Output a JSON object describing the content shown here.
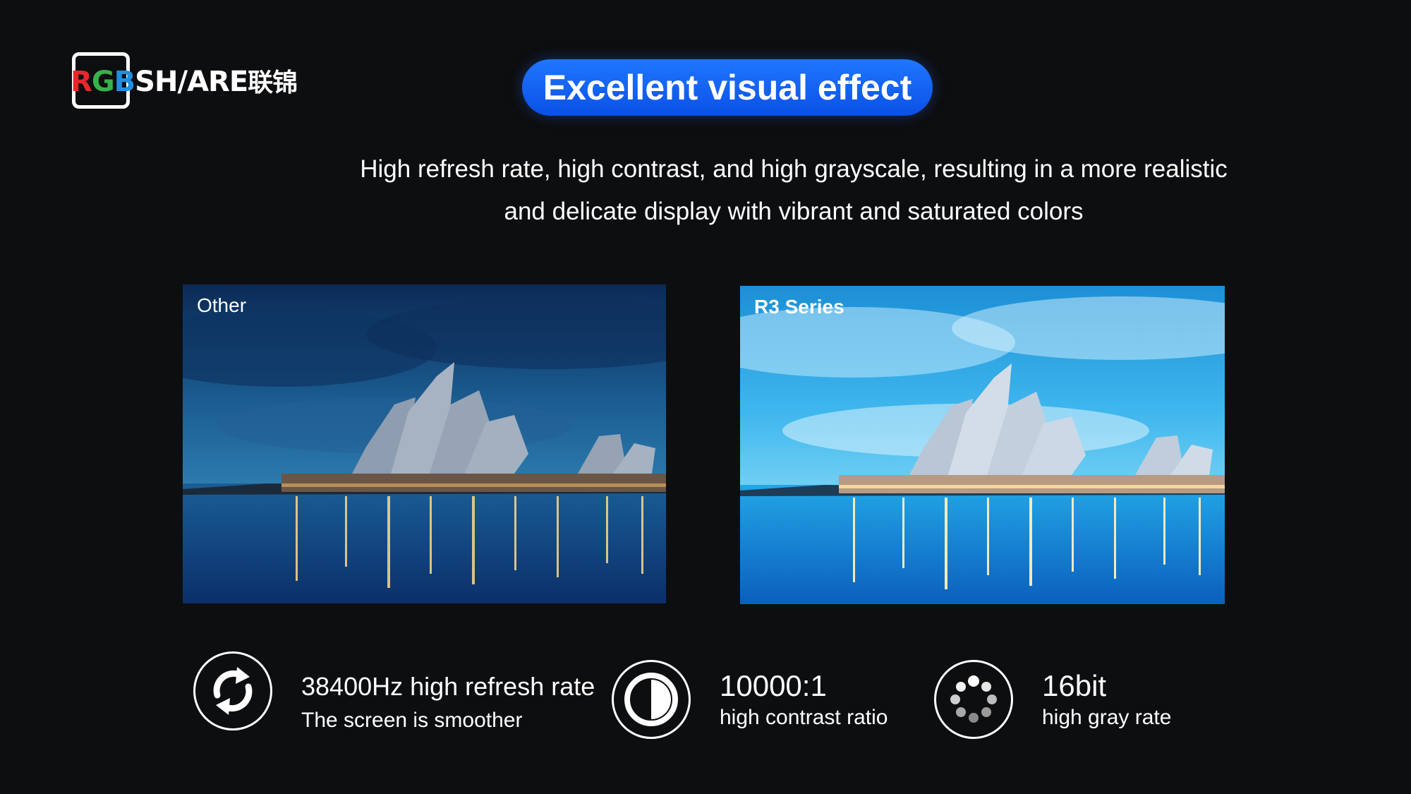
{
  "brand": {
    "logo_letters": [
      "R",
      "G",
      "B",
      "SH",
      "/",
      "ARE"
    ],
    "logo_cn": "联锦",
    "colors": {
      "red": "#e8262c",
      "green": "#37b24a",
      "blue": "#1f8fe0"
    }
  },
  "header": {
    "title": "Excellent visual effect",
    "pill_color": "#0a50e6"
  },
  "intro": {
    "line1": "High refresh rate, high contrast, and high grayscale, resulting in a more realistic",
    "line2": "and delicate display with vibrant and saturated colors"
  },
  "comparison": {
    "left_label": "Other",
    "right_label": "R3 Series"
  },
  "features": [
    {
      "icon": "refresh-arrows-icon",
      "main": "38400Hz high refresh rate",
      "sub": "The screen is smoother"
    },
    {
      "icon": "contrast-half-circle-icon",
      "main": "10000:1",
      "sub": "high contrast ratio"
    },
    {
      "icon": "grayscale-dots-icon",
      "main": "16bit",
      "sub": "high gray rate"
    }
  ]
}
